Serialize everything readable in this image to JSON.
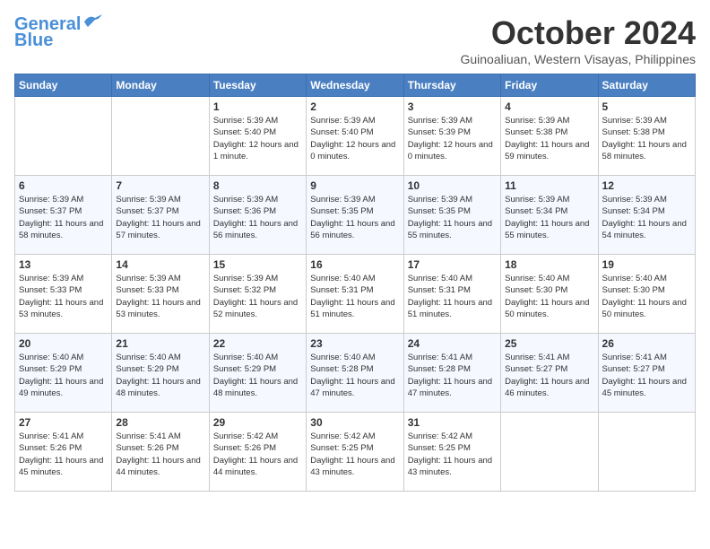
{
  "logo": {
    "line1": "General",
    "line2": "Blue"
  },
  "title": "October 2024",
  "location": "Guinoaliuan, Western Visayas, Philippines",
  "days_header": [
    "Sunday",
    "Monday",
    "Tuesday",
    "Wednesday",
    "Thursday",
    "Friday",
    "Saturday"
  ],
  "weeks": [
    [
      {
        "day": "",
        "info": ""
      },
      {
        "day": "",
        "info": ""
      },
      {
        "day": "1",
        "info": "Sunrise: 5:39 AM\nSunset: 5:40 PM\nDaylight: 12 hours\nand 1 minute."
      },
      {
        "day": "2",
        "info": "Sunrise: 5:39 AM\nSunset: 5:40 PM\nDaylight: 12 hours\nand 0 minutes."
      },
      {
        "day": "3",
        "info": "Sunrise: 5:39 AM\nSunset: 5:39 PM\nDaylight: 12 hours\nand 0 minutes."
      },
      {
        "day": "4",
        "info": "Sunrise: 5:39 AM\nSunset: 5:38 PM\nDaylight: 11 hours\nand 59 minutes."
      },
      {
        "day": "5",
        "info": "Sunrise: 5:39 AM\nSunset: 5:38 PM\nDaylight: 11 hours\nand 58 minutes."
      }
    ],
    [
      {
        "day": "6",
        "info": "Sunrise: 5:39 AM\nSunset: 5:37 PM\nDaylight: 11 hours\nand 58 minutes."
      },
      {
        "day": "7",
        "info": "Sunrise: 5:39 AM\nSunset: 5:37 PM\nDaylight: 11 hours\nand 57 minutes."
      },
      {
        "day": "8",
        "info": "Sunrise: 5:39 AM\nSunset: 5:36 PM\nDaylight: 11 hours\nand 56 minutes."
      },
      {
        "day": "9",
        "info": "Sunrise: 5:39 AM\nSunset: 5:35 PM\nDaylight: 11 hours\nand 56 minutes."
      },
      {
        "day": "10",
        "info": "Sunrise: 5:39 AM\nSunset: 5:35 PM\nDaylight: 11 hours\nand 55 minutes."
      },
      {
        "day": "11",
        "info": "Sunrise: 5:39 AM\nSunset: 5:34 PM\nDaylight: 11 hours\nand 55 minutes."
      },
      {
        "day": "12",
        "info": "Sunrise: 5:39 AM\nSunset: 5:34 PM\nDaylight: 11 hours\nand 54 minutes."
      }
    ],
    [
      {
        "day": "13",
        "info": "Sunrise: 5:39 AM\nSunset: 5:33 PM\nDaylight: 11 hours\nand 53 minutes."
      },
      {
        "day": "14",
        "info": "Sunrise: 5:39 AM\nSunset: 5:33 PM\nDaylight: 11 hours\nand 53 minutes."
      },
      {
        "day": "15",
        "info": "Sunrise: 5:39 AM\nSunset: 5:32 PM\nDaylight: 11 hours\nand 52 minutes."
      },
      {
        "day": "16",
        "info": "Sunrise: 5:40 AM\nSunset: 5:31 PM\nDaylight: 11 hours\nand 51 minutes."
      },
      {
        "day": "17",
        "info": "Sunrise: 5:40 AM\nSunset: 5:31 PM\nDaylight: 11 hours\nand 51 minutes."
      },
      {
        "day": "18",
        "info": "Sunrise: 5:40 AM\nSunset: 5:30 PM\nDaylight: 11 hours\nand 50 minutes."
      },
      {
        "day": "19",
        "info": "Sunrise: 5:40 AM\nSunset: 5:30 PM\nDaylight: 11 hours\nand 50 minutes."
      }
    ],
    [
      {
        "day": "20",
        "info": "Sunrise: 5:40 AM\nSunset: 5:29 PM\nDaylight: 11 hours\nand 49 minutes."
      },
      {
        "day": "21",
        "info": "Sunrise: 5:40 AM\nSunset: 5:29 PM\nDaylight: 11 hours\nand 48 minutes."
      },
      {
        "day": "22",
        "info": "Sunrise: 5:40 AM\nSunset: 5:29 PM\nDaylight: 11 hours\nand 48 minutes."
      },
      {
        "day": "23",
        "info": "Sunrise: 5:40 AM\nSunset: 5:28 PM\nDaylight: 11 hours\nand 47 minutes."
      },
      {
        "day": "24",
        "info": "Sunrise: 5:41 AM\nSunset: 5:28 PM\nDaylight: 11 hours\nand 47 minutes."
      },
      {
        "day": "25",
        "info": "Sunrise: 5:41 AM\nSunset: 5:27 PM\nDaylight: 11 hours\nand 46 minutes."
      },
      {
        "day": "26",
        "info": "Sunrise: 5:41 AM\nSunset: 5:27 PM\nDaylight: 11 hours\nand 45 minutes."
      }
    ],
    [
      {
        "day": "27",
        "info": "Sunrise: 5:41 AM\nSunset: 5:26 PM\nDaylight: 11 hours\nand 45 minutes."
      },
      {
        "day": "28",
        "info": "Sunrise: 5:41 AM\nSunset: 5:26 PM\nDaylight: 11 hours\nand 44 minutes."
      },
      {
        "day": "29",
        "info": "Sunrise: 5:42 AM\nSunset: 5:26 PM\nDaylight: 11 hours\nand 44 minutes."
      },
      {
        "day": "30",
        "info": "Sunrise: 5:42 AM\nSunset: 5:25 PM\nDaylight: 11 hours\nand 43 minutes."
      },
      {
        "day": "31",
        "info": "Sunrise: 5:42 AM\nSunset: 5:25 PM\nDaylight: 11 hours\nand 43 minutes."
      },
      {
        "day": "",
        "info": ""
      },
      {
        "day": "",
        "info": ""
      }
    ]
  ]
}
